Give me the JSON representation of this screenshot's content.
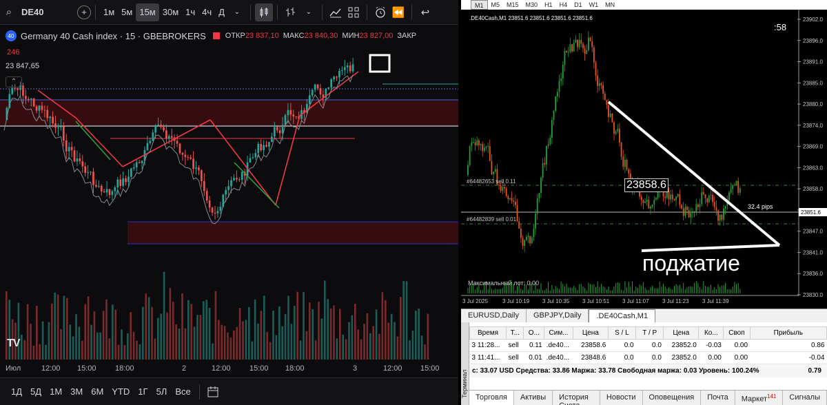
{
  "tv": {
    "symbol": "DE40",
    "timeframes": [
      "1м",
      "5м",
      "15м",
      "30м",
      "1ч",
      "4ч",
      "Д"
    ],
    "active_timeframe": "15м",
    "legend": {
      "badge": "40",
      "instrument": "Germany 40 Cash index · 15 · GBEBROKERS",
      "open_label": "ОТКР",
      "open_value": "23 837,10",
      "high_label": "МАКС",
      "high_value": "23 840,30",
      "low_label": "МИН",
      "low_value": "23 827,00",
      "close_label": "ЗАКР",
      "sell_value": "246",
      "buy_value": "23 847,65"
    },
    "x_labels": [
      "Июл",
      "12:00",
      "15:00",
      "18:00",
      "2",
      "12:00",
      "15:00",
      "18:00",
      "3",
      "12:00",
      "15:00"
    ],
    "ranges": [
      "1Д",
      "5Д",
      "1М",
      "3М",
      "6М",
      "YTD",
      "1Г",
      "5Л",
      "Все"
    ],
    "logo": "TV",
    "colors": {
      "up": "#26a69a",
      "down": "#ef5350",
      "pattern": "#f23645",
      "zone": "#3a0d12"
    }
  },
  "mt": {
    "timeframes": [
      "M1",
      "M5",
      "M15",
      "M30",
      "H1",
      "H4",
      "D1",
      "W1",
      "MN"
    ],
    "active_timeframe": "M1",
    "chart_header": ".DE40Cash,M1  23851.6 23851.6 23851.6 23851.6",
    "countdown": ":58",
    "price_labels": [
      "23902.0",
      "23896.0",
      "23891.0",
      "23885.0",
      "23880.0",
      "23874.0",
      "23869.0",
      "23863.0",
      "23858.0",
      "23852.0",
      "23847.0",
      "23841.0",
      "23836.0",
      "23830.0"
    ],
    "current_price": "23851.6",
    "time_labels": [
      "3 Jul 2025",
      "3 Jul 10:19",
      "3 Jul 10:35",
      "3 Jul 10:51",
      "3 Jul 11:07",
      "3 Jul 11:23",
      "3 Jul 11:39"
    ],
    "order1_label": "#64482653 sell 0.11",
    "order2_label": "#64482839 sell 0.01",
    "price_box": "23858.6",
    "pips_label": "32.4 pips",
    "annotation": "поджатие",
    "max_lot": "Максимальный лот: 0.00",
    "chart_tabs": [
      "EURUSD,Daily",
      "GBPJPY,Daily",
      ".DE40Cash,M1"
    ],
    "active_chart_tab": ".DE40Cash,M1",
    "terminal": {
      "side_label": "Терминал",
      "columns": [
        "Время",
        "Т...",
        "О...",
        "Сим...",
        "Цена",
        "S / L",
        "T / P",
        "Цена",
        "Ко...",
        "Своп",
        "Прибыль"
      ],
      "rows": [
        [
          "3 11:28...",
          "sell",
          "0.11",
          ".de40...",
          "23858.6",
          "0.0",
          "0.0",
          "23852.0",
          "-0.03",
          "0.00",
          "0.86"
        ],
        [
          "3 11:41...",
          "sell",
          "0.01",
          ".de40...",
          "23848.6",
          "0.0",
          "0.0",
          "23852.0",
          "0.00",
          "0.00",
          "-0.04"
        ]
      ],
      "balance_line": "с: 33.07 USD  Средства: 33.86  Маржа: 33.78  Свободная маржа: 0.03  Уровень: 100.24%",
      "total_profit": "0.79",
      "tabs": [
        "Торговля",
        "Активы",
        "История Счета",
        "Новости",
        "Оповещения",
        "Почта",
        "Маркет",
        "Сигналы"
      ],
      "active_tab": "Торговля",
      "market_badge": "141"
    }
  }
}
